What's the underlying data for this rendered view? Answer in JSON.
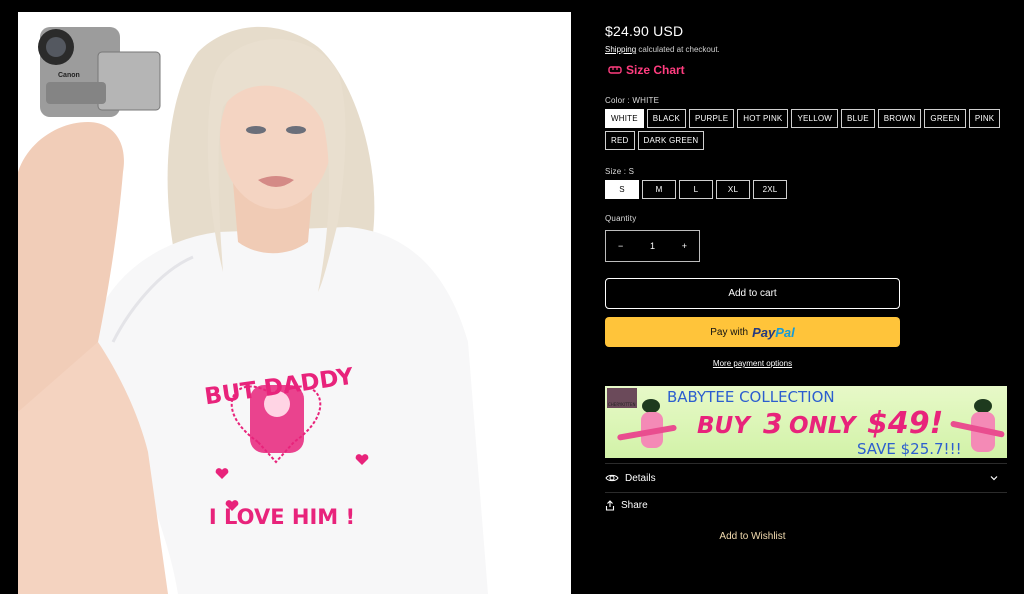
{
  "product": {
    "price": "$24.90 USD",
    "shipping_link": "Shipping",
    "shipping_text": "calculated at checkout.",
    "size_chart_label": "Size Chart",
    "shirt_text_top": "BUT DADDY",
    "shirt_text_bottom": "I LOVE HIM !",
    "camera_brand": "Canon"
  },
  "color": {
    "label": "Color : WHITE",
    "options": [
      "WHITE",
      "BLACK",
      "PURPLE",
      "HOT PINK",
      "YELLOW",
      "BLUE",
      "BROWN",
      "GREEN",
      "PINK",
      "RED",
      "DARK GREEN"
    ],
    "selected": "WHITE"
  },
  "size": {
    "label": "Size : S",
    "options": [
      "S",
      "M",
      "L",
      "XL",
      "2XL"
    ],
    "selected": "S"
  },
  "quantity": {
    "label": "Quantity",
    "value": "1",
    "minus": "−",
    "plus": "+"
  },
  "buttons": {
    "add_to_cart": "Add to cart",
    "paypal_prefix": "Pay with",
    "paypal_brand_1": "Pay",
    "paypal_brand_2": "Pal",
    "more_payment": "More payment options",
    "add_to_wishlist": "Add to Wishlist"
  },
  "banner": {
    "brand": "CHERYKITTEN",
    "title": "BABYTEE COLLECTION",
    "line1_a": "BUY",
    "line1_b": "3",
    "line1_c": "ONLY",
    "line1_d": "$49!",
    "line2": "SAVE $25.7!!!"
  },
  "accordion": {
    "details": "Details",
    "share": "Share"
  },
  "colors": {
    "accent_pink": "#ff3d7f",
    "paypal_yellow": "#ffc43a",
    "background": "#000000"
  }
}
